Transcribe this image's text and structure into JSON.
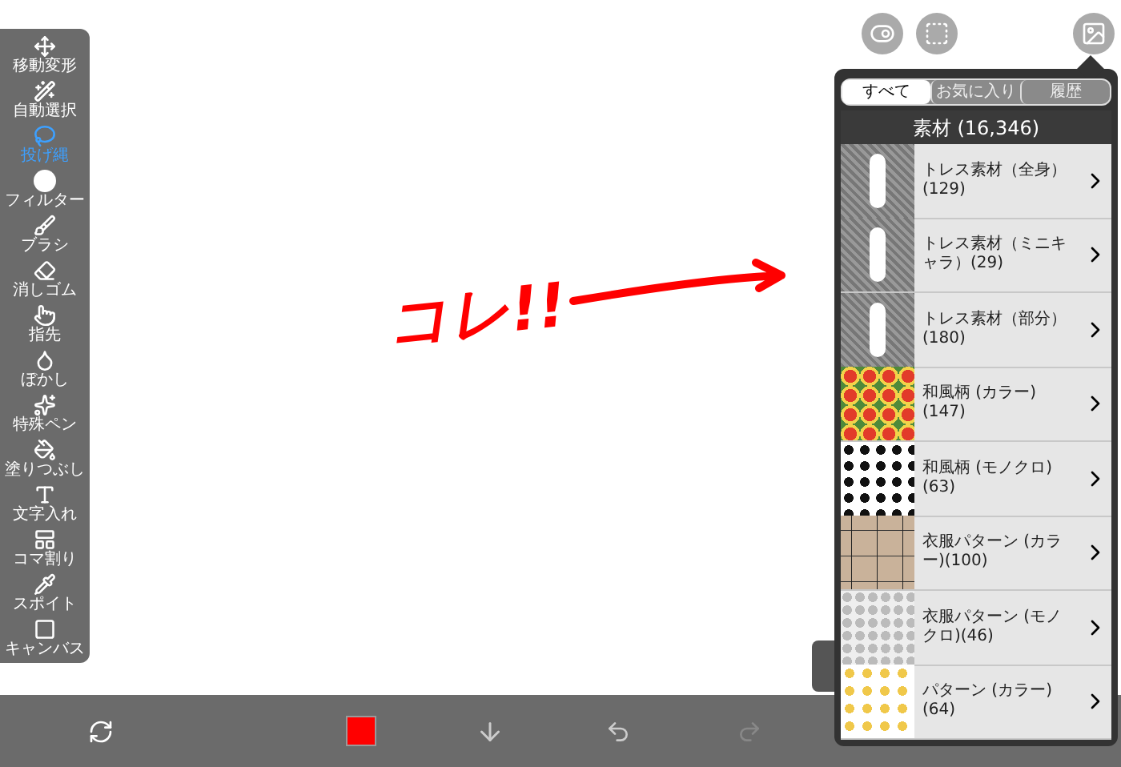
{
  "tools": [
    {
      "label": "移動変形",
      "selected": false
    },
    {
      "label": "自動選択",
      "selected": false
    },
    {
      "label": "投げ縄",
      "selected": true
    },
    {
      "label": "フィルター",
      "selected": false
    },
    {
      "label": "ブラシ",
      "selected": false
    },
    {
      "label": "消しゴム",
      "selected": false
    },
    {
      "label": "指先",
      "selected": false
    },
    {
      "label": "ぼかし",
      "selected": false
    },
    {
      "label": "特殊ペン",
      "selected": false
    },
    {
      "label": "塗りつぶし",
      "selected": false
    },
    {
      "label": "文字入れ",
      "selected": false
    },
    {
      "label": "コマ割り",
      "selected": false
    },
    {
      "label": "スポイト",
      "selected": false
    },
    {
      "label": "キャンバス",
      "selected": false
    }
  ],
  "canvas": {
    "handwriting": "コレ!!"
  },
  "panel": {
    "tabs": [
      {
        "label": "すべて",
        "selected": true
      },
      {
        "label": "お気に入り",
        "selected": false
      },
      {
        "label": "履歴",
        "selected": false
      }
    ],
    "header": "素材 (16,346)",
    "items": [
      {
        "label": "トレス素材（全身）(129)"
      },
      {
        "label": "トレス素材（ミニキャラ）(29)"
      },
      {
        "label": "トレス素材（部分）(180)"
      },
      {
        "label": "和風柄 (カラー)(147)"
      },
      {
        "label": "和風柄 (モノクロ)(63)"
      },
      {
        "label": "衣服パターン (カラー)(100)"
      },
      {
        "label": "衣服パターン (モノクロ)(46)"
      },
      {
        "label": "パターン (カラー)(64)"
      }
    ]
  },
  "bottom_bar": {
    "color_swatch": {
      "color": "#ff0000"
    },
    "redo": {
      "disabled": true
    }
  }
}
